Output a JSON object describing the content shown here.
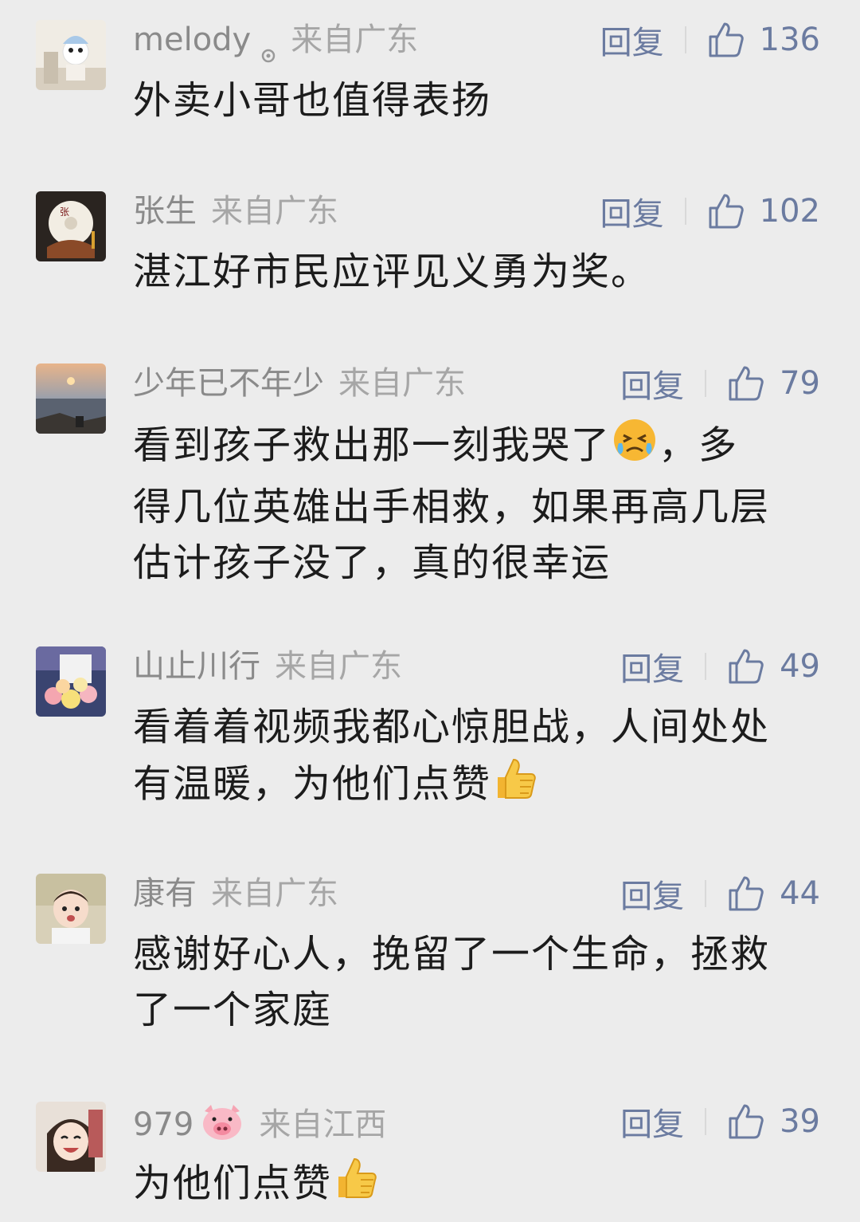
{
  "comments": [
    {
      "username": "melody",
      "location": "来自广东",
      "reply_label": "回复",
      "likes": "136",
      "text": "外卖小哥也值得表扬"
    },
    {
      "username": "张生",
      "location": "来自广东",
      "reply_label": "回复",
      "likes": "102",
      "text": "湛江好市民应评见义勇为奖。"
    },
    {
      "username": "少年已不年少",
      "location": "来自广东",
      "reply_label": "回复",
      "likes": "79",
      "text_lines": [
        "看到孩子救出那一刻我哭了",
        "，多",
        "得几位英雄出手相救，如果再高几层",
        "估计孩子没了，真的很幸运"
      ],
      "emoji": "crying-face"
    },
    {
      "username": "山止川行",
      "location": "来自广东",
      "reply_label": "回复",
      "likes": "49",
      "text_lines": [
        "看着着视频我都心惊胆战，人间处处",
        "有温暖，为他们点赞"
      ],
      "emoji": "thumbs-up"
    },
    {
      "username": "康有",
      "location": "来自广东",
      "reply_label": "回复",
      "likes": "44",
      "text_lines": [
        "感谢好心人，挽留了一个生命，拯救",
        "了一个家庭"
      ]
    },
    {
      "username": "979",
      "username_emoji": "pig-face",
      "location": "来自江西",
      "reply_label": "回复",
      "likes": "39",
      "text": "为他们点赞",
      "emoji": "thumbs-up"
    }
  ],
  "colors": {
    "background": "#ececec",
    "link_blue": "#6b7ba0",
    "meta_gray": "#8f8f8f",
    "text": "#1c1c1c"
  }
}
